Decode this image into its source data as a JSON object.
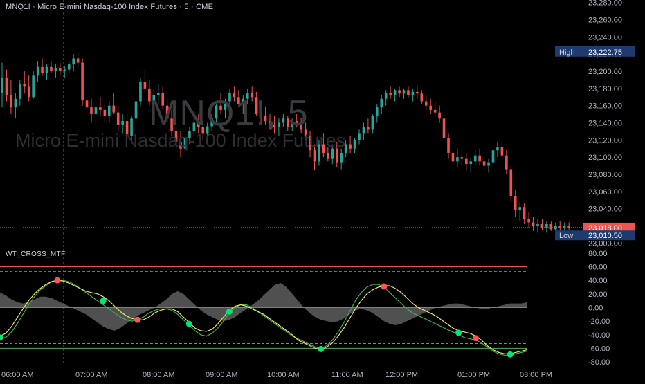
{
  "header": {
    "symbol_line": "MNQ1! · Micro E-mini Nasdaq-100 Index Futures · 5 · CME"
  },
  "watermark": {
    "symbol": "MNQ1!, 5",
    "description": "Micro E-mini Nasdaq-100 Index Futures"
  },
  "indicator": {
    "name": "WT_CROSS_MTF"
  },
  "price_labels": {
    "high_label": "High",
    "high_value": "23,222.75",
    "last_value": "23,018.00",
    "low_label": "Low",
    "low_value": "23,010.50"
  },
  "colors": {
    "up": "#26a69a",
    "down": "#ef5350",
    "wt1": "#f2e55c",
    "wt2": "#3fae5a",
    "histogram": "#6b6b6b",
    "label_bg": "#1e3a6e",
    "last_bg": "#ef5350"
  },
  "chart_data": [
    {
      "type": "candlestick",
      "title": "MNQ1! · Micro E-mini Nasdaq-100 Index Futures · 5 · CME",
      "x_ticks": [
        "06:00 AM",
        "07:00 AM",
        "08:00 AM",
        "09:00 AM",
        "10:00 AM",
        "11:00 AM",
        "12:00 PM",
        "01:00 PM",
        "03:00 PM"
      ],
      "y_ticks": [
        "23,280.00",
        "23,260.00",
        "23,240.00",
        "23,220.00",
        "23,200.00",
        "23,180.00",
        "23,160.00",
        "23,140.00",
        "23,120.00",
        "23,100.00",
        "23,080.00",
        "23,060.00",
        "23,040.00",
        "23,020.00",
        "23,000.00"
      ],
      "ylim": [
        22997,
        23283
      ],
      "high": 23222.75,
      "low": 23010.5,
      "last": 23018.0,
      "candles": [
        [
          23175,
          23210,
          23158,
          23192
        ],
        [
          23192,
          23202,
          23165,
          23172
        ],
        [
          23172,
          23190,
          23150,
          23158
        ],
        [
          23158,
          23175,
          23145,
          23168
        ],
        [
          23168,
          23190,
          23160,
          23185
        ],
        [
          23185,
          23200,
          23175,
          23182
        ],
        [
          23182,
          23195,
          23165,
          23170
        ],
        [
          23170,
          23200,
          23168,
          23195
        ],
        [
          23195,
          23212,
          23188,
          23205
        ],
        [
          23205,
          23215,
          23195,
          23198
        ],
        [
          23198,
          23208,
          23190,
          23205
        ],
        [
          23205,
          23212,
          23198,
          23200
        ],
        [
          23200,
          23208,
          23192,
          23204
        ],
        [
          23204,
          23210,
          23196,
          23200
        ],
        [
          23200,
          23206,
          23192,
          23202
        ],
        [
          23202,
          23212,
          23198,
          23208
        ],
        [
          23208,
          23220,
          23200,
          23215
        ],
        [
          23215,
          23222,
          23205,
          23210
        ],
        [
          23210,
          23215,
          23160,
          23166
        ],
        [
          23166,
          23185,
          23150,
          23158
        ],
        [
          23158,
          23168,
          23140,
          23150
        ],
        [
          23150,
          23162,
          23135,
          23158
        ],
        [
          23158,
          23170,
          23148,
          23155
        ],
        [
          23155,
          23162,
          23140,
          23148
        ],
        [
          23148,
          23165,
          23140,
          23160
        ],
        [
          23160,
          23175,
          23150,
          23152
        ],
        [
          23152,
          23160,
          23130,
          23138
        ],
        [
          23138,
          23150,
          23128,
          23142
        ],
        [
          23142,
          23150,
          23120,
          23125
        ],
        [
          23125,
          23148,
          23118,
          23145
        ],
        [
          23145,
          23170,
          23140,
          23165
        ],
        [
          23165,
          23192,
          23160,
          23188
        ],
        [
          23188,
          23202,
          23175,
          23180
        ],
        [
          23180,
          23190,
          23160,
          23165
        ],
        [
          23165,
          23180,
          23150,
          23172
        ],
        [
          23172,
          23185,
          23162,
          23175
        ],
        [
          23175,
          23182,
          23155,
          23160
        ],
        [
          23160,
          23170,
          23140,
          23145
        ],
        [
          23145,
          23155,
          23125,
          23130
        ],
        [
          23130,
          23140,
          23110,
          23118
        ],
        [
          23118,
          23130,
          23100,
          23110
        ],
        [
          23110,
          23128,
          23105,
          23122
        ],
        [
          23122,
          23135,
          23115,
          23130
        ],
        [
          23130,
          23145,
          23125,
          23140
        ],
        [
          23140,
          23150,
          23128,
          23135
        ],
        [
          23135,
          23142,
          23120,
          23128
        ],
        [
          23128,
          23140,
          23122,
          23136
        ],
        [
          23136,
          23150,
          23130,
          23145
        ],
        [
          23145,
          23165,
          23140,
          23160
        ],
        [
          23160,
          23175,
          23150,
          23155
        ],
        [
          23155,
          23168,
          23145,
          23165
        ],
        [
          23165,
          23180,
          23160,
          23175
        ],
        [
          23175,
          23182,
          23165,
          23170
        ],
        [
          23170,
          23178,
          23158,
          23162
        ],
        [
          23162,
          23172,
          23150,
          23168
        ],
        [
          23168,
          23180,
          23162,
          23175
        ],
        [
          23175,
          23182,
          23165,
          23170
        ],
        [
          23170,
          23176,
          23148,
          23150
        ],
        [
          23150,
          23160,
          23140,
          23148
        ],
        [
          23148,
          23158,
          23138,
          23142
        ],
        [
          23142,
          23150,
          23132,
          23138
        ],
        [
          23138,
          23148,
          23128,
          23135
        ],
        [
          23135,
          23145,
          23125,
          23140
        ],
        [
          23140,
          23150,
          23135,
          23145
        ],
        [
          23145,
          23148,
          23130,
          23135
        ],
        [
          23135,
          23145,
          23130,
          23142
        ],
        [
          23142,
          23150,
          23135,
          23138
        ],
        [
          23138,
          23146,
          23128,
          23132
        ],
        [
          23132,
          23140,
          23120,
          23124
        ],
        [
          23124,
          23130,
          23100,
          23108
        ],
        [
          23108,
          23115,
          23085,
          23095
        ],
        [
          23095,
          23120,
          23090,
          23115
        ],
        [
          23115,
          23128,
          23100,
          23105
        ],
        [
          23105,
          23112,
          23095,
          23098
        ],
        [
          23098,
          23115,
          23092,
          23110
        ],
        [
          23110,
          23118,
          23088,
          23094
        ],
        [
          23094,
          23110,
          23086,
          23105
        ],
        [
          23105,
          23120,
          23100,
          23115
        ],
        [
          23115,
          23125,
          23105,
          23110
        ],
        [
          23110,
          23122,
          23105,
          23120
        ],
        [
          23120,
          23132,
          23115,
          23128
        ],
        [
          23128,
          23140,
          23120,
          23135
        ],
        [
          23135,
          23145,
          23128,
          23132
        ],
        [
          23132,
          23150,
          23128,
          23148
        ],
        [
          23148,
          23162,
          23140,
          23158
        ],
        [
          23158,
          23172,
          23150,
          23168
        ],
        [
          23168,
          23178,
          23160,
          23175
        ],
        [
          23175,
          23182,
          23168,
          23172
        ],
        [
          23172,
          23180,
          23165,
          23178
        ],
        [
          23178,
          23182,
          23170,
          23174
        ],
        [
          23174,
          23180,
          23168,
          23178
        ],
        [
          23178,
          23182,
          23170,
          23172
        ],
        [
          23172,
          23180,
          23165,
          23176
        ],
        [
          23176,
          23182,
          23168,
          23174
        ],
        [
          23174,
          23178,
          23162,
          23165
        ],
        [
          23165,
          23172,
          23155,
          23160
        ],
        [
          23160,
          23168,
          23150,
          23155
        ],
        [
          23155,
          23165,
          23148,
          23152
        ],
        [
          23152,
          23160,
          23140,
          23145
        ],
        [
          23145,
          23150,
          23118,
          23122
        ],
        [
          23122,
          23128,
          23098,
          23105
        ],
        [
          23105,
          23112,
          23085,
          23095
        ],
        [
          23095,
          23110,
          23088,
          23100
        ],
        [
          23100,
          23108,
          23090,
          23098
        ],
        [
          23098,
          23105,
          23085,
          23092
        ],
        [
          23092,
          23100,
          23082,
          23095
        ],
        [
          23095,
          23108,
          23090,
          23102
        ],
        [
          23102,
          23110,
          23090,
          23095
        ],
        [
          23095,
          23100,
          23085,
          23090
        ],
        [
          23090,
          23098,
          23082,
          23094
        ],
        [
          23094,
          23112,
          23090,
          23108
        ],
        [
          23108,
          23118,
          23100,
          23112
        ],
        [
          23112,
          23118,
          23098,
          23102
        ],
        [
          23102,
          23108,
          23080,
          23086
        ],
        [
          23086,
          23090,
          23048,
          23055
        ],
        [
          23055,
          23062,
          23030,
          23038
        ],
        [
          23038,
          23048,
          23025,
          23042
        ],
        [
          23042,
          23046,
          23022,
          23028
        ],
        [
          23028,
          23036,
          23018,
          23024
        ],
        [
          23024,
          23030,
          23014,
          23020
        ],
        [
          23020,
          23028,
          23012,
          23022
        ],
        [
          23022,
          23028,
          23015,
          23018
        ],
        [
          23018,
          23026,
          23012,
          23022
        ],
        [
          23022,
          23025,
          23014,
          23016
        ],
        [
          23016,
          23024,
          23010,
          23020
        ],
        [
          23020,
          23026,
          23014,
          23018
        ],
        [
          23018,
          23024,
          23012,
          23020
        ],
        [
          23020,
          23024,
          23015,
          23018
        ]
      ]
    },
    {
      "type": "line",
      "title": "WT_CROSS_MTF",
      "y_ticks": [
        "80.00",
        "60.00",
        "40.00",
        "20.00",
        "0.00",
        "-20.00",
        "-40.00",
        "-60.00",
        "-80.00"
      ],
      "ylim": [
        -85,
        88
      ],
      "levels": {
        "ob1": 60,
        "ob2": 53,
        "os1": -53,
        "os2": -60
      },
      "series": [
        {
          "values": [
            -42,
            -38,
            -28,
            -15,
            -2,
            10,
            20,
            28,
            34,
            38,
            40,
            39,
            36,
            32,
            28,
            24,
            22,
            20,
            16,
            10,
            2,
            -6,
            -12,
            -16,
            -18,
            -18,
            -14,
            -8,
            -4,
            -2,
            -2,
            -6,
            -14,
            -22,
            -30,
            -34,
            -35,
            -32,
            -24,
            -14,
            -4,
            2,
            4,
            2,
            -2,
            -6,
            -10,
            -16,
            -22,
            -28,
            -34,
            -40,
            -48,
            -52,
            -56,
            -60,
            -62,
            -58,
            -52,
            -42,
            -30,
            -16,
            -2,
            10,
            20,
            26,
            30,
            32,
            32,
            28,
            22,
            14,
            6,
            0,
            -4,
            -8,
            -12,
            -18,
            -24,
            -30,
            -34,
            -36,
            -38,
            -42,
            -48,
            -56,
            -62,
            -66,
            -68,
            -68,
            -66,
            -64,
            -62
          ]
        },
        {
          "values": [
            -46,
            -44,
            -36,
            -24,
            -10,
            4,
            16,
            26,
            32,
            38,
            40,
            40,
            38,
            34,
            28,
            22,
            16,
            10,
            4,
            -2,
            -8,
            -14,
            -18,
            -20,
            -18,
            -14,
            -8,
            -4,
            -2,
            -2,
            -4,
            -10,
            -18,
            -26,
            -34,
            -40,
            -42,
            -38,
            -30,
            -20,
            -8,
            0,
            4,
            4,
            0,
            -6,
            -12,
            -18,
            -24,
            -30,
            -36,
            -42,
            -46,
            -50,
            -54,
            -58,
            -60,
            -56,
            -48,
            -36,
            -22,
            -6,
            10,
            22,
            30,
            34,
            34,
            30,
            22,
            14,
            6,
            -2,
            -8,
            -12,
            -16,
            -20,
            -24,
            -28,
            -32,
            -36,
            -40,
            -44,
            -46,
            -48,
            -52,
            -58,
            -64,
            -68,
            -70,
            -70,
            -68,
            -66,
            -64
          ]
        },
        {
          "values": [
            22,
            18,
            12,
            8,
            6,
            8,
            12,
            16,
            16,
            14,
            10,
            6,
            2,
            -2,
            -6,
            -10,
            -16,
            -22,
            -28,
            -32,
            -34,
            -30,
            -24,
            -18,
            -12,
            -8,
            -4,
            0,
            6,
            12,
            20,
            24,
            20,
            12,
            4,
            -4,
            -10,
            -14,
            -18,
            -20,
            -18,
            -14,
            -8,
            -2,
            4,
            10,
            18,
            26,
            34,
            36,
            30,
            20,
            10,
            0,
            -8,
            -14,
            -18,
            -20,
            -22,
            -20,
            -16,
            -10,
            -4,
            -2,
            -4,
            -8,
            -14,
            -20,
            -24,
            -26,
            -24,
            -20,
            -16,
            -12,
            -8,
            -4,
            0,
            2,
            4,
            6,
            6,
            4,
            2,
            0,
            -2,
            -2,
            0,
            2,
            4,
            6,
            6,
            6,
            8
          ]
        }
      ],
      "cross_dots": [
        {
          "i": 0,
          "color": "green"
        },
        {
          "i": 10,
          "color": "red"
        },
        {
          "i": 18,
          "color": "green"
        },
        {
          "i": 24,
          "color": "red"
        },
        {
          "i": 33,
          "color": "green"
        },
        {
          "i": 40,
          "color": "green"
        },
        {
          "i": 56,
          "color": "green"
        },
        {
          "i": 67,
          "color": "red"
        },
        {
          "i": 80,
          "color": "green"
        },
        {
          "i": 83,
          "color": "red"
        },
        {
          "i": 89,
          "color": "green"
        }
      ]
    }
  ]
}
